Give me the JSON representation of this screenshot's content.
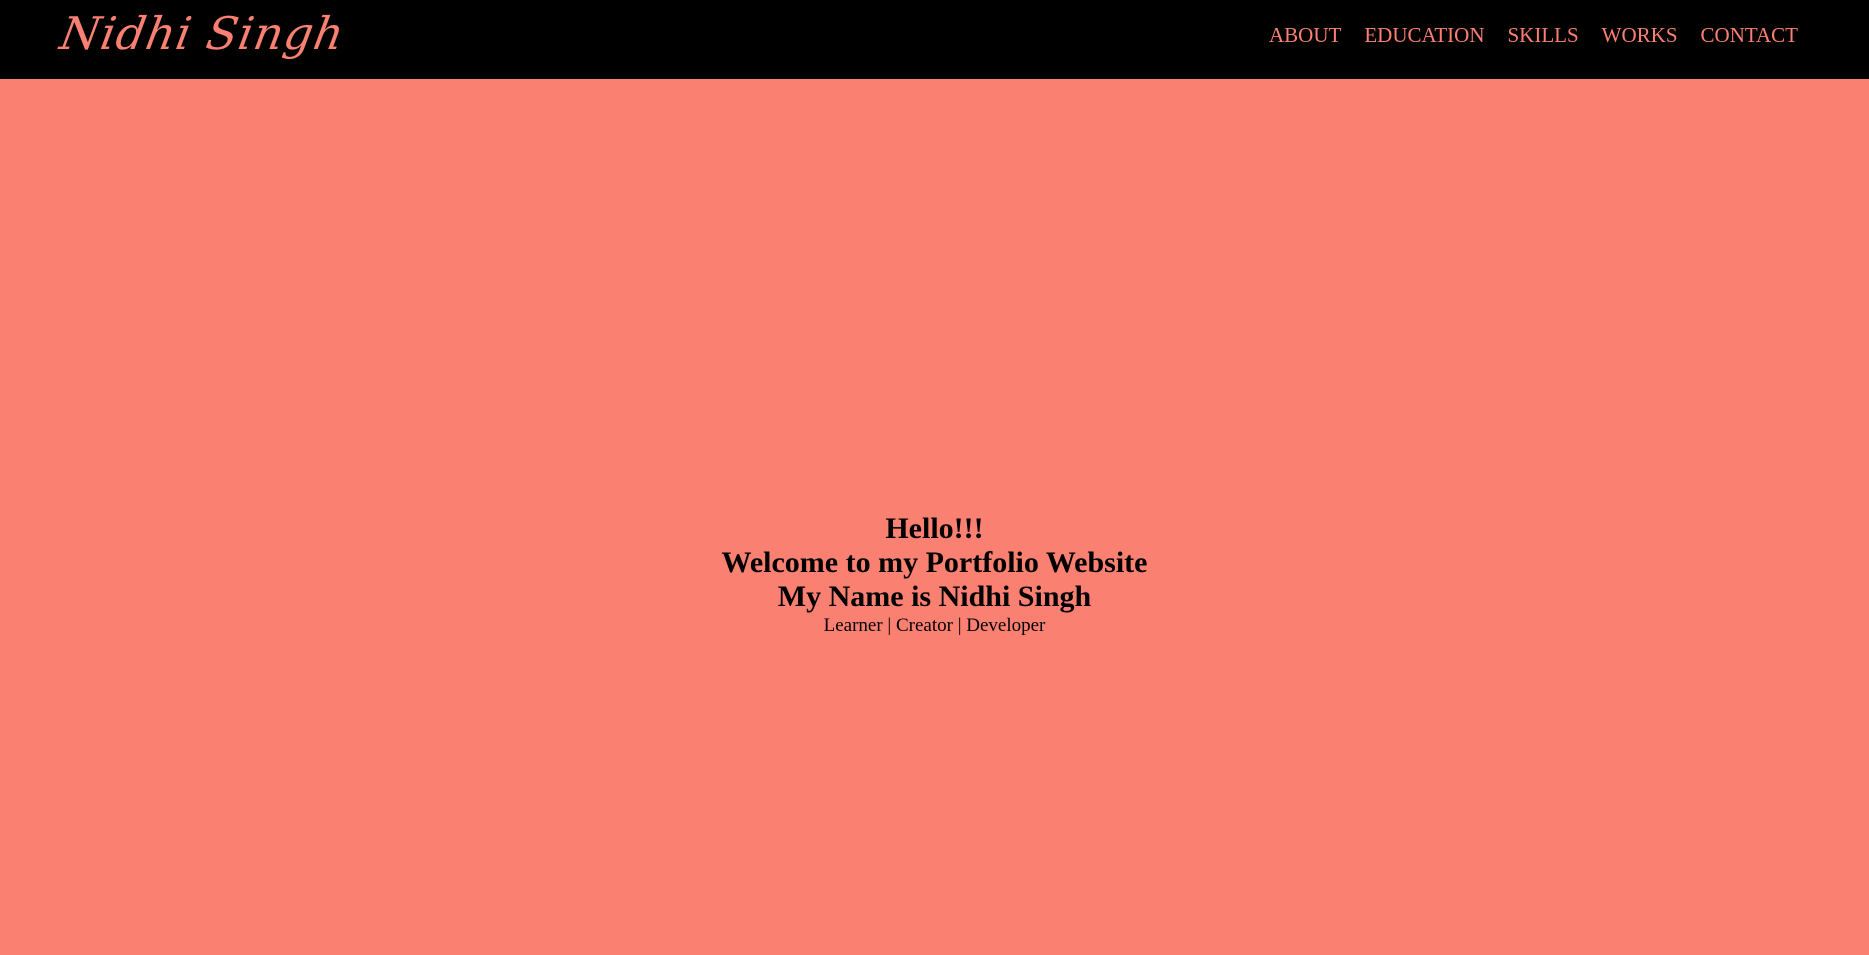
{
  "colors": {
    "header_background": "#000000",
    "accent": "#fa8072",
    "page_background": "#fa8072",
    "text": "#000000"
  },
  "header": {
    "logo_text": "Nidhi Singh",
    "nav_items": [
      {
        "label": "ABOUT"
      },
      {
        "label": "EDUCATION"
      },
      {
        "label": "SKILLS"
      },
      {
        "label": "WORKS"
      },
      {
        "label": "CONTACT"
      }
    ]
  },
  "hero": {
    "lines": [
      "Hello!!!",
      "Welcome to my Portfolio Website",
      "My Name is Nidhi Singh"
    ],
    "subtitle": "Learner | Creator | Developer"
  }
}
